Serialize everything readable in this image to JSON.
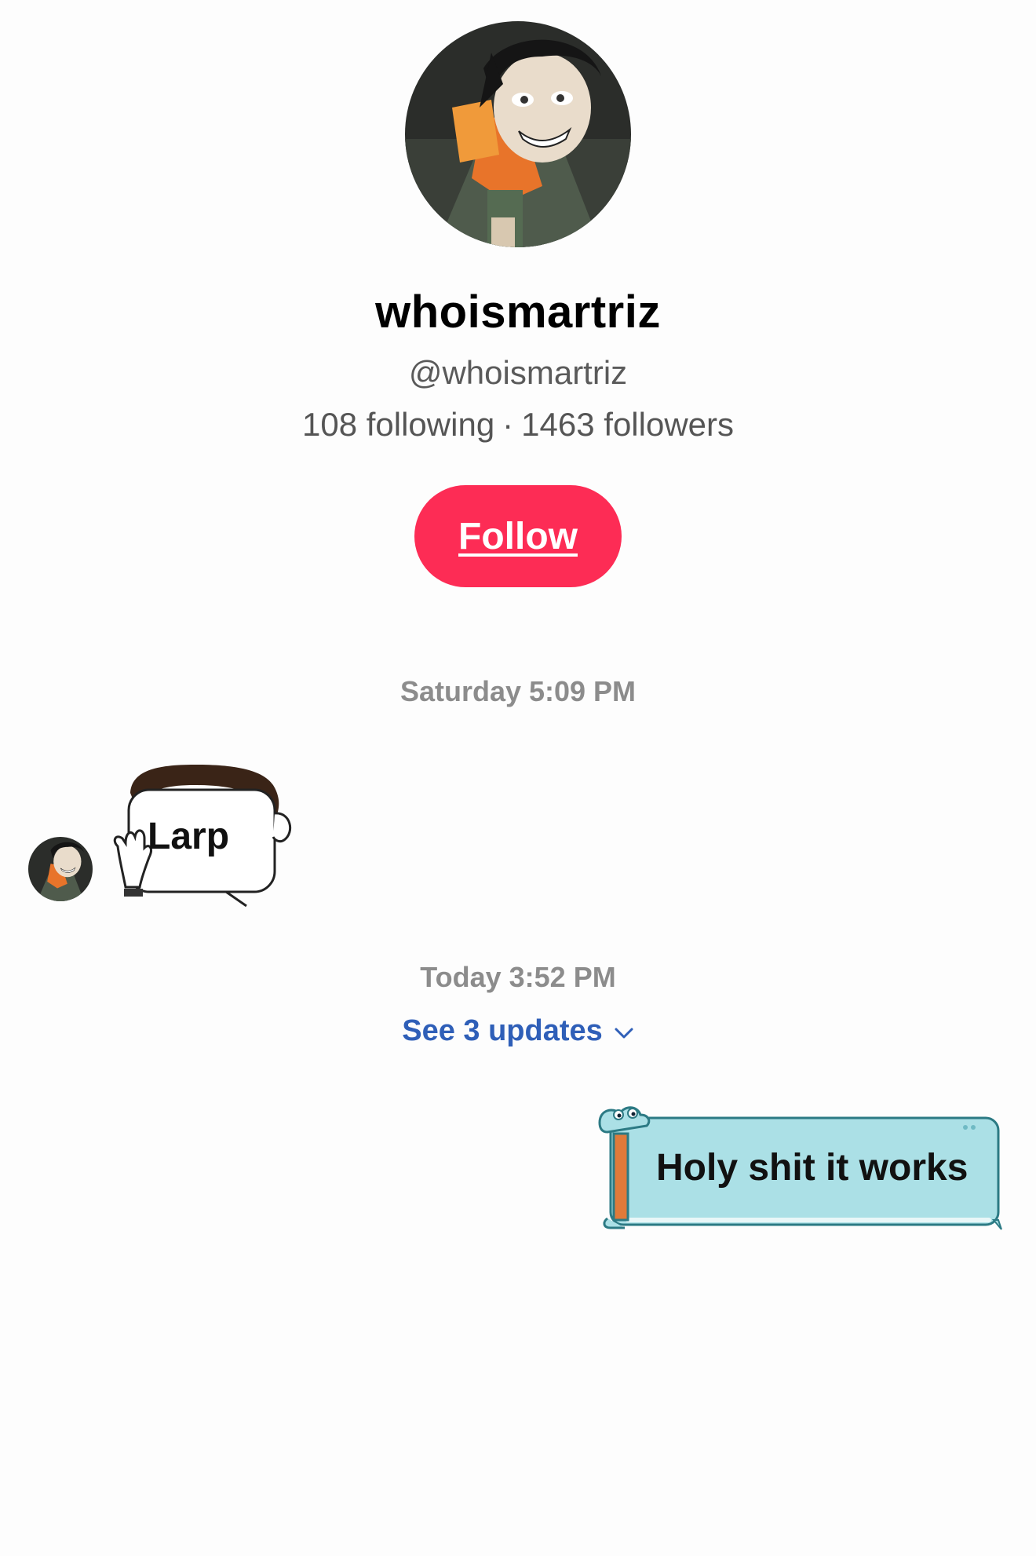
{
  "profile": {
    "display_name": "whoismartriz",
    "handle": "@whoismartriz",
    "following": "108 following",
    "separator": "·",
    "followers": "1463 followers",
    "follow_label": "Follow",
    "avatar_icon": "anime-character-avatar-icon"
  },
  "chat": {
    "timestamp_1": "Saturday 5:09 PM",
    "message_1": "Larp",
    "timestamp_2": "Today 3:52 PM",
    "see_updates": "See 3 updates",
    "message_2": "Holy shit it works"
  },
  "colors": {
    "follow_button": "#fd2c55",
    "link_blue": "#2f5fb8",
    "timestamp_gray": "#8c8c8c",
    "sticker_teal": "#abe0e6"
  }
}
